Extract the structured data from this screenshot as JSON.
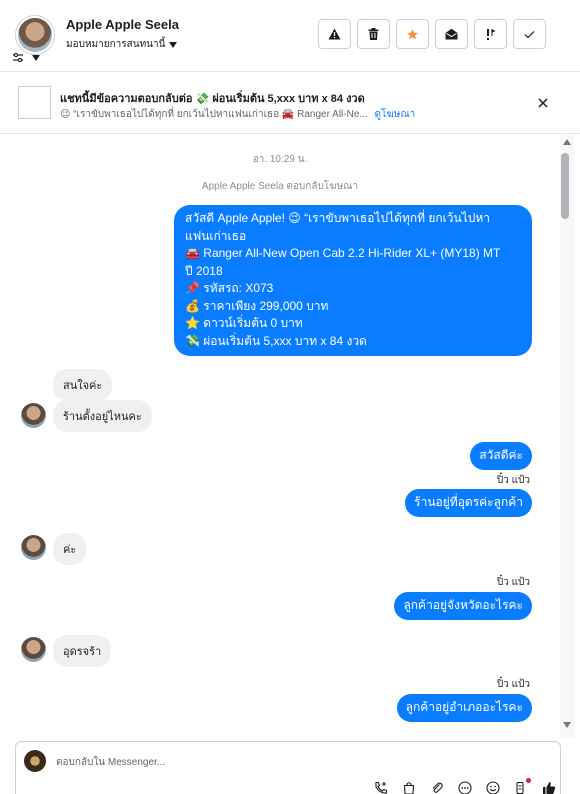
{
  "header": {
    "contact_name": "Apple Apple Seela",
    "assign_label": "มอบหมายการสนทนานี้",
    "toolbar": {
      "spam_icon": "warning-icon",
      "delete_icon": "trash-icon",
      "star_icon": "star-icon",
      "unread_icon": "envelope-open-icon",
      "priority_icon": "priority-icon",
      "done_icon": "check-icon"
    },
    "star_color": "#f7923b"
  },
  "ad": {
    "title": "แชทนี้มีข้อความตอบกลับต่อ 💸 ผ่อนเริ่มต้น 5,xxx บาท x 84 งวด",
    "subtitle": "😉 “เราขับพาเธอไปได้ทุกที่ ยกเว้นไปหาแฟนเก่าเธอ 🚘 Ranger All-Ne...",
    "link": "ดูโฆษณา"
  },
  "chat": {
    "timestamp": "อา. 10:29 น.",
    "replied_note": "Apple Apple Seela ตอบกลับโฆษณา",
    "ad_message_lines": [
      "สวัสดี Apple Apple! 😉 “เราขับพาเธอไปได้ทุกที่ ยกเว้นไปหา",
      "แฟนเก่าเธอ",
      "🚘 Ranger All-New Open Cab 2.2 Hi-Rider XL+ (MY18) MT",
      "ปี 2018",
      "📌 รหัสรถ: X073",
      "💰 ราคาเพียง 299,000 บาท",
      "⭐ ดาวน์เริ่มต้น 0 บาท",
      "💸 ผ่อนเริ่มต้น 5,xxx บาท x 84 งวด"
    ],
    "in_1": "สนใจค่ะ",
    "in_2": "ร้านตั้งอยู่ไหนคะ",
    "out_1": "สวัสดีค่ะ",
    "sender": "ปิ๋ว แป้ว",
    "out_2": "ร้านอยู่ที่อุดรค่ะลูกค้า",
    "in_3": "ค่ะ",
    "out_3": "ลูกค้าอยู่จังหวัดอะไรคะ",
    "in_4": "อุดรจร้า",
    "out_4": "ลูกค้าอยู่อำเภออะไรคะ",
    "out_color": "#0a7cff"
  },
  "composer": {
    "placeholder": "ตอบกลับใน Messenger..."
  }
}
